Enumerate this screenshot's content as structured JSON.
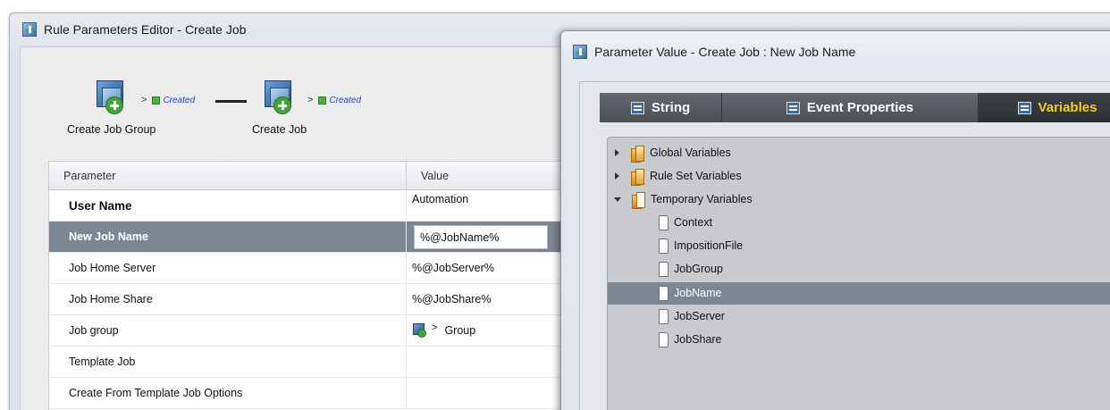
{
  "editor": {
    "title": "Rule Parameters Editor - Create Job",
    "workflow": {
      "nodes": [
        {
          "label": "Create Job Group",
          "status": "Created"
        },
        {
          "label": "Create Job",
          "status": "Created"
        }
      ],
      "chevron": ">"
    },
    "table": {
      "headers": {
        "parameter": "Parameter",
        "value": "Value"
      },
      "rows": [
        {
          "parameter": "User Name",
          "value": "Automation"
        },
        {
          "parameter": "New Job Name",
          "value": "%@JobName%"
        },
        {
          "parameter": "Job Home Server",
          "value": "%@JobServer%"
        },
        {
          "parameter": "Job Home Share",
          "value": "%@JobShare%"
        },
        {
          "parameter": "Job group",
          "value": "Group",
          "value_chevron": ">"
        },
        {
          "parameter": "Template Job",
          "value": ""
        },
        {
          "parameter": "Create From Template Job Options",
          "value": ""
        }
      ]
    }
  },
  "dialog": {
    "title": "Parameter Value - Create Job : New Job Name",
    "tabs": [
      {
        "label": "String",
        "icon": "string-icon"
      },
      {
        "label": "Event Properties",
        "icon": "event-properties-icon"
      },
      {
        "label": "Variables",
        "icon": "variables-icon",
        "active": true
      }
    ],
    "tree": {
      "groups": [
        {
          "label": "Global Variables",
          "expanded": false
        },
        {
          "label": "Rule Set Variables",
          "expanded": false
        },
        {
          "label": "Temporary Variables",
          "expanded": true
        }
      ],
      "variables": [
        "Context",
        "ImpositionFile",
        "JobGroup",
        "JobName",
        "JobServer",
        "JobShare"
      ],
      "selected": "JobName"
    }
  },
  "colors": {
    "selection": "#7d8793",
    "active_tab_text": "#f4cd2b",
    "status_text": "#1f3ec6",
    "status_check": "#4ab040"
  }
}
